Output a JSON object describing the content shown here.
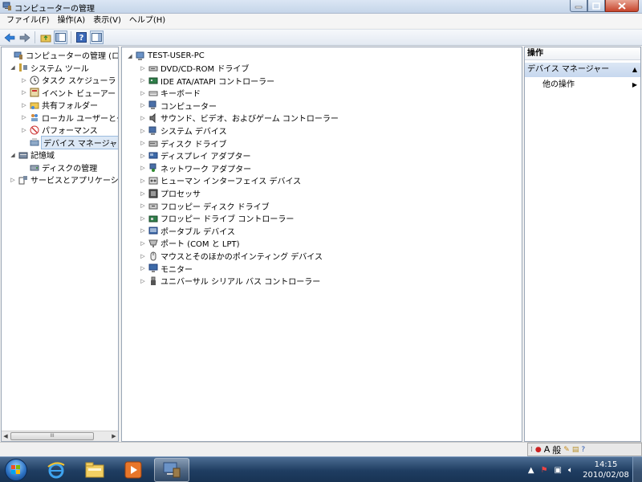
{
  "window": {
    "title": "コンピューターの管理"
  },
  "menu": [
    "ファイル(F)",
    "操作(A)",
    "表示(V)",
    "ヘルプ(H)"
  ],
  "left_tree": [
    {
      "label": "コンピューターの管理 (ローカ",
      "level": 0,
      "expander": "",
      "icon": "computer-management-icon"
    },
    {
      "label": "システム ツール",
      "level": 1,
      "expander": "◢",
      "icon": "tools-icon"
    },
    {
      "label": "タスク スケジューラ",
      "level": 2,
      "expander": "▷",
      "icon": "clock-icon"
    },
    {
      "label": "イベント ビューアー",
      "level": 2,
      "expander": "▷",
      "icon": "event-viewer-icon"
    },
    {
      "label": "共有フォルダー",
      "level": 2,
      "expander": "▷",
      "icon": "shared-folder-icon"
    },
    {
      "label": "ローカル ユーザーとグ",
      "level": 2,
      "expander": "▷",
      "icon": "users-icon"
    },
    {
      "label": "パフォーマンス",
      "level": 2,
      "expander": "▷",
      "icon": "performance-icon"
    },
    {
      "label": "デバイス マネージャー",
      "level": 2,
      "expander": "",
      "icon": "device-manager-icon",
      "selected": true
    },
    {
      "label": "記憶域",
      "level": 1,
      "expander": "◢",
      "icon": "storage-icon"
    },
    {
      "label": "ディスクの管理",
      "level": 2,
      "expander": "",
      "icon": "disk-management-icon"
    },
    {
      "label": "サービスとアプリケーショ",
      "level": 1,
      "expander": "▷",
      "icon": "services-icon"
    }
  ],
  "hscroll": {
    "thumb_grip": "III"
  },
  "device_tree": {
    "root": "TEST-USER-PC",
    "root_expander": "◢",
    "items": [
      {
        "label": "DVD/CD-ROM ドライブ",
        "icon": "dvd-drive-icon"
      },
      {
        "label": "IDE ATA/ATAPI コントローラー",
        "icon": "ide-controller-icon"
      },
      {
        "label": "キーボード",
        "icon": "keyboard-icon"
      },
      {
        "label": "コンピューター",
        "icon": "computer-icon"
      },
      {
        "label": "サウンド、ビデオ、およびゲーム コントローラー",
        "icon": "speaker-icon"
      },
      {
        "label": "システム デバイス",
        "icon": "system-devices-icon"
      },
      {
        "label": "ディスク ドライブ",
        "icon": "disk-drive-icon"
      },
      {
        "label": "ディスプレイ アダプター",
        "icon": "display-adapter-icon"
      },
      {
        "label": "ネットワーク アダプター",
        "icon": "network-adapter-icon"
      },
      {
        "label": "ヒューマン インターフェイス デバイス",
        "icon": "hid-icon"
      },
      {
        "label": "プロセッサ",
        "icon": "processor-icon"
      },
      {
        "label": "フロッピー ディスク ドライブ",
        "icon": "floppy-drive-icon"
      },
      {
        "label": "フロッピー ドライブ コントローラー",
        "icon": "floppy-controller-icon"
      },
      {
        "label": "ポータブル デバイス",
        "icon": "portable-device-icon"
      },
      {
        "label": "ポート (COM と LPT)",
        "icon": "port-icon"
      },
      {
        "label": "マウスとそのほかのポインティング デバイス",
        "icon": "mouse-icon"
      },
      {
        "label": "モニター",
        "icon": "monitor-icon"
      },
      {
        "label": "ユニバーサル シリアル バス コントローラー",
        "icon": "usb-icon"
      }
    ]
  },
  "actions": {
    "header": "操作",
    "section": "デバイス マネージャー",
    "item": "他の操作"
  },
  "ime": {
    "mode": "A",
    "kanji": "般"
  },
  "clock": {
    "time": "14:15",
    "date": "2010/02/08"
  },
  "colors": {
    "taskbar": "#1f3d61",
    "selection": "#dce8f6",
    "actions_section": "#c6d7ee"
  }
}
